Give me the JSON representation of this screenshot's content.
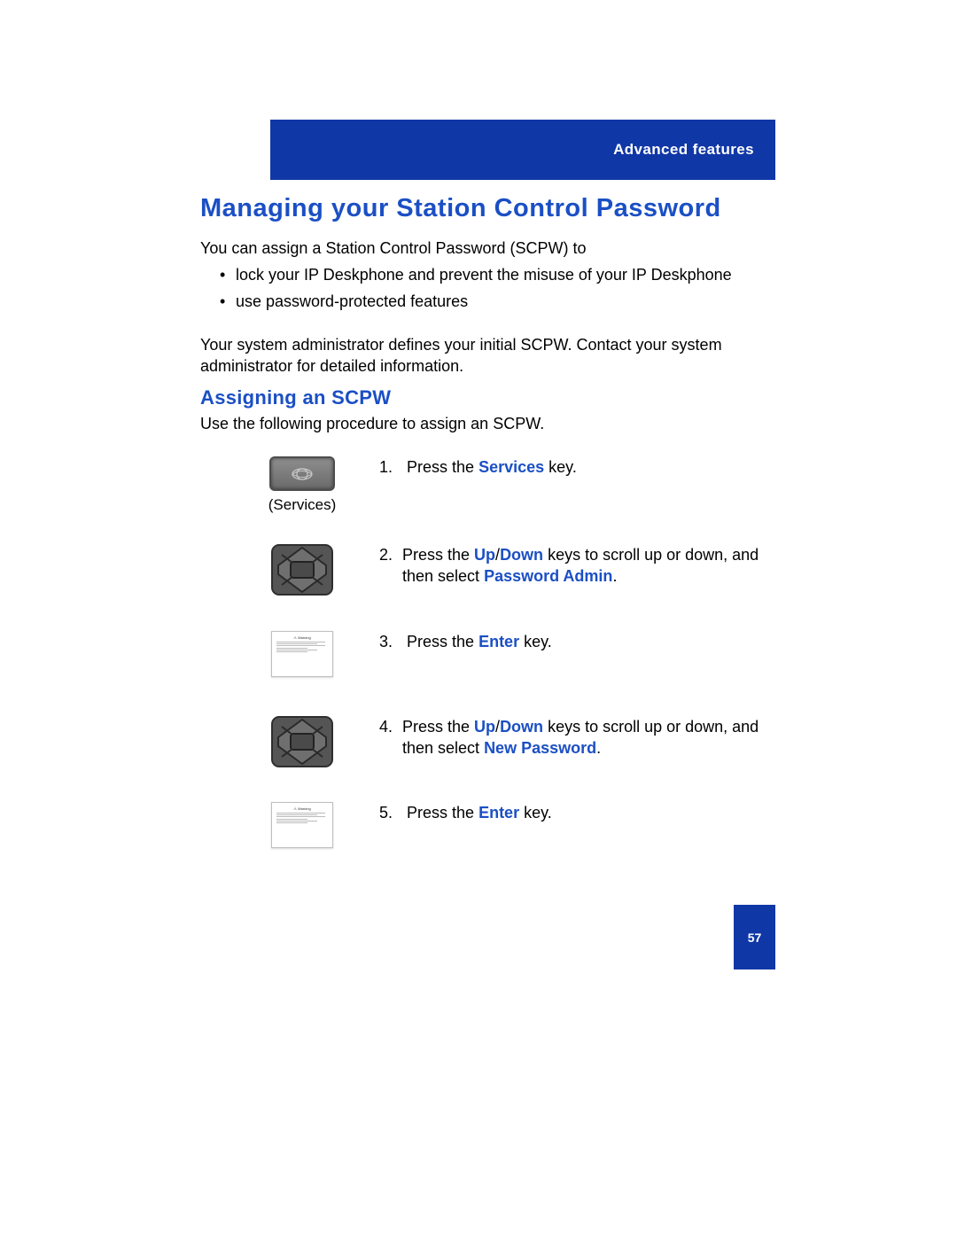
{
  "header": {
    "section": "Advanced features"
  },
  "h1": "Managing your Station Control Password",
  "intro": "You can assign a Station Control Password (SCPW) to",
  "bullets": [
    "lock your IP Deskphone and prevent the misuse of your IP Deskphone",
    "use password-protected features"
  ],
  "admin_para": "Your system administrator defines your initial SCPW. Contact your system administrator for detailed information.",
  "h2": "Assigning an SCPW",
  "h2_sub": "Use the following procedure to assign an SCPW.",
  "steps": {
    "s1": {
      "icon_label": "(Services)",
      "num": "1.",
      "pre": "Press the ",
      "hl1": "Services",
      "post": " key."
    },
    "s2": {
      "num": "2.",
      "pre": "Press the ",
      "hl1": "Up",
      "sep": "/",
      "hl2": "Down",
      "mid": " keys to scroll up or down, and then select ",
      "hl3": "Password Admin",
      "post": "."
    },
    "s3": {
      "num": "3.",
      "pre": "Press the ",
      "hl1": "Enter",
      "post": " key."
    },
    "s4": {
      "num": "4.",
      "pre": "Press the ",
      "hl1": "Up",
      "sep": "/",
      "hl2": "Down",
      "mid": " keys to scroll up or down, and then select ",
      "hl3": "New Password",
      "post": "."
    },
    "s5": {
      "num": "5.",
      "pre": "Press the ",
      "hl1": "Enter",
      "post": " key."
    }
  },
  "footer": {
    "page_number": "57"
  }
}
